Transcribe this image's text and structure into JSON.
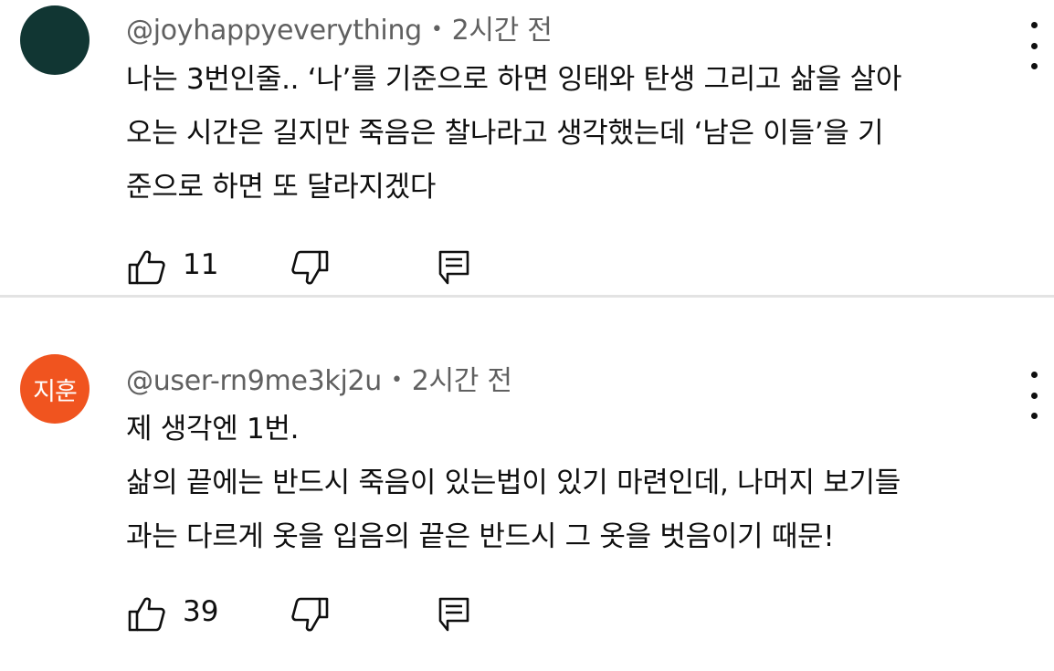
{
  "comments": [
    {
      "author": "@joyhappyeverything",
      "separator": "•",
      "time": "2시간 전",
      "avatar_text": "",
      "avatar_color": "#113633",
      "lines": [
        "나는 3번인줄.. ‘나’를 기준으로 하면 잉태와 탄생 그리고 삶을 살아",
        "오는 시간은 길지만 죽음은 찰나라고 생각했는데 ‘남은 이들’을 기",
        "준으로 하면 또 달라지겠다"
      ],
      "likes": "11",
      "icons": [
        "thumbs-up-icon",
        "thumbs-down-icon",
        "reply-icon",
        "more-vert-icon"
      ]
    },
    {
      "author": "@user-rn9me3kj2u",
      "separator": "•",
      "time": "2시간 전",
      "avatar_text": "지훈",
      "avatar_color": "#f0541f",
      "lines": [
        "제 생각엔 1번.",
        "삶의 끝에는 반드시 죽음이 있는법이 있기 마련인데, 나머지 보기들",
        "과는 다르게 옷을 입음의 끝은 반드시 그 옷을 벗음이기 때문!"
      ],
      "likes": "39",
      "icons": [
        "thumbs-up-icon",
        "thumbs-down-icon",
        "reply-icon",
        "more-vert-icon"
      ]
    }
  ]
}
